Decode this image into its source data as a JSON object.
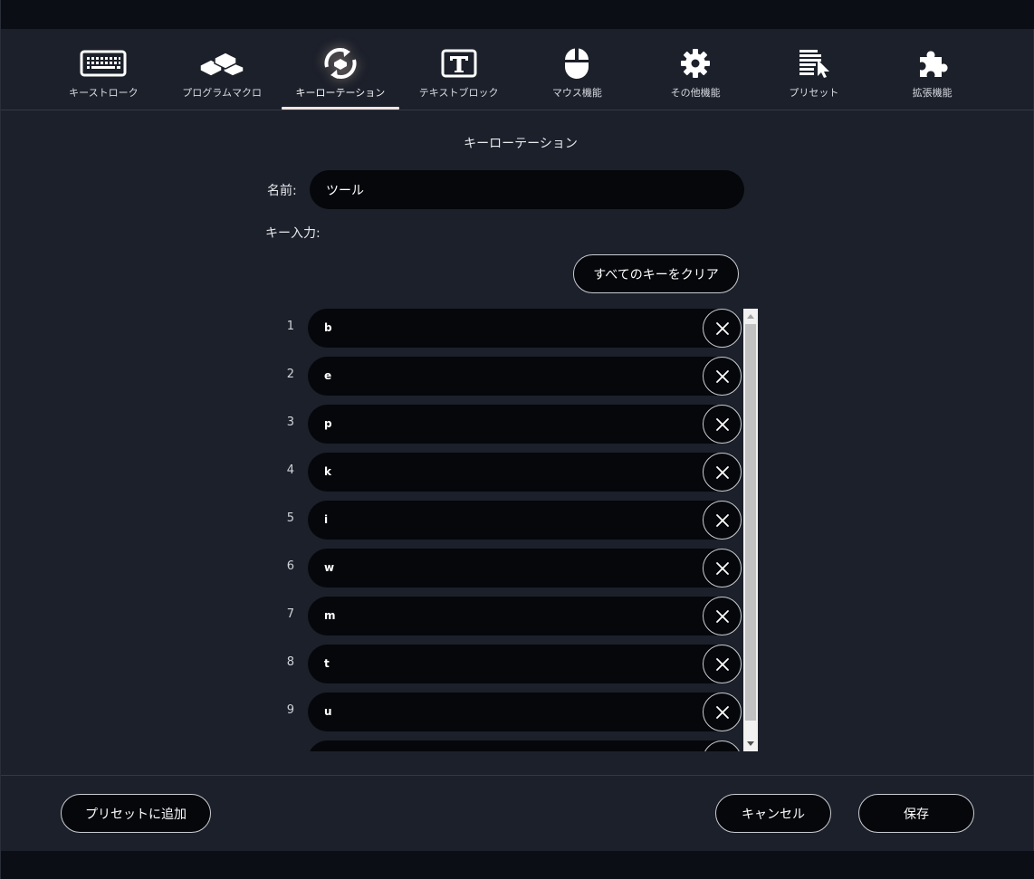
{
  "tabs": [
    {
      "label": "キーストローク",
      "icon": "keyboard-icon",
      "active": false
    },
    {
      "label": "プログラムマクロ",
      "icon": "macro-blocks-icon",
      "active": false
    },
    {
      "label": "キーローテーション",
      "icon": "key-rotation-icon",
      "active": true
    },
    {
      "label": "テキストブロック",
      "icon": "text-block-icon",
      "active": false
    },
    {
      "label": "マウス機能",
      "icon": "mouse-icon",
      "active": false
    },
    {
      "label": "その他機能",
      "icon": "gear-icon",
      "active": false
    },
    {
      "label": "プリセット",
      "icon": "preset-list-icon",
      "active": false
    },
    {
      "label": "拡張機能",
      "icon": "puzzle-icon",
      "active": false
    }
  ],
  "section_title": "キーローテーション",
  "name": {
    "label": "名前:",
    "value": "ツール"
  },
  "keys_label": "キー入力:",
  "clear_all_label": "すべてのキーをクリア",
  "keys": [
    {
      "index": "1",
      "key": "b"
    },
    {
      "index": "2",
      "key": "e"
    },
    {
      "index": "3",
      "key": "p"
    },
    {
      "index": "4",
      "key": "k"
    },
    {
      "index": "5",
      "key": "i"
    },
    {
      "index": "6",
      "key": "w"
    },
    {
      "index": "7",
      "key": "m"
    },
    {
      "index": "8",
      "key": "t"
    },
    {
      "index": "9",
      "key": "u"
    },
    {
      "index": "",
      "key": ""
    }
  ],
  "footer": {
    "add_preset_label": "プリセットに追加",
    "cancel_label": "キャンセル",
    "save_label": "保存"
  },
  "colors": {
    "background": "#1c202a",
    "field": "#05070b",
    "active_underline": "#f0e6e0"
  }
}
